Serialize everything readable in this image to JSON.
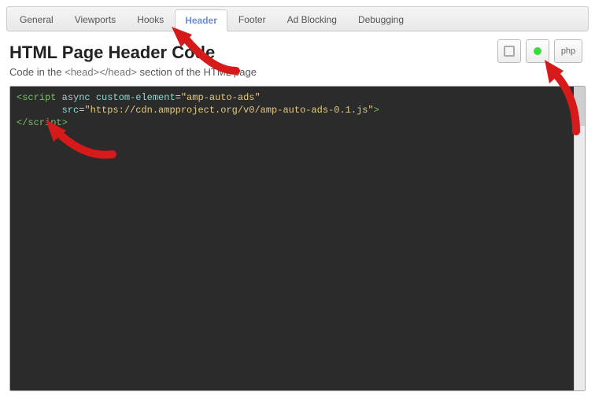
{
  "tabs": {
    "items": [
      {
        "label": "General"
      },
      {
        "label": "Viewports"
      },
      {
        "label": "Hooks"
      },
      {
        "label": "Header"
      },
      {
        "label": "Footer"
      },
      {
        "label": "Ad Blocking"
      },
      {
        "label": "Debugging"
      }
    ],
    "active_index": 3
  },
  "header": {
    "title": "HTML Page Header Code",
    "subtitle_pre": "Code in the ",
    "subtitle_tag": "<head></head>",
    "subtitle_post": " section of the HTML page"
  },
  "buttons": {
    "php_label": "php"
  },
  "code": {
    "line1_open": "<script",
    "line1_attrs": " async custom-element",
    "line1_eq": "=",
    "line1_val1": "\"amp-auto-ads\"",
    "line2_indent": "        ",
    "line2_src": "src",
    "line2_eq": "=",
    "line2_val": "\"https://cdn.ampproject.org/v0/amp-auto-ads-0.1.js\"",
    "line2_close": ">",
    "line3_close": "</script>"
  }
}
